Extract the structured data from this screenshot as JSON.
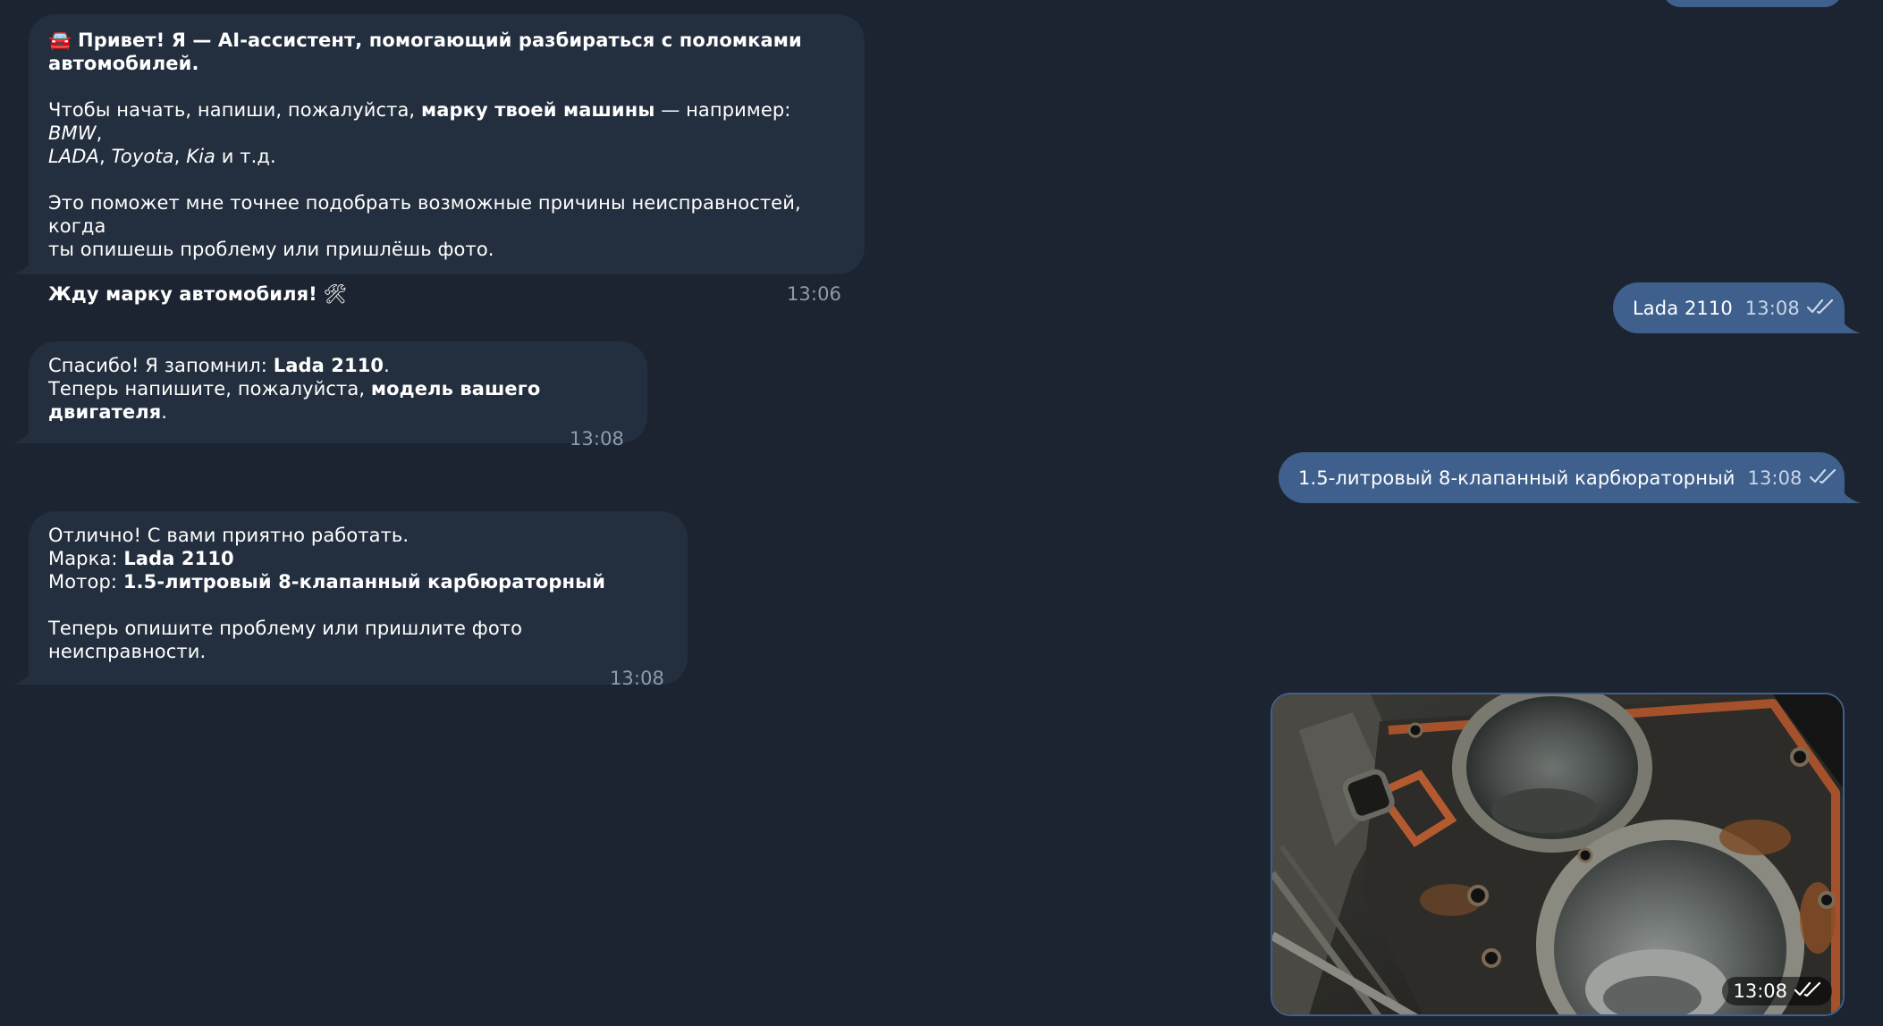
{
  "messages": {
    "m1": {
      "emoji": "🚘",
      "title_part1": "Привет! Я — AI-ассистент, помогающий разбираться с поломками",
      "title_part2": "автомобилей.",
      "p2_a": "Чтобы начать, напиши, пожалуйста, ",
      "p2_b": "марку твоей машины",
      "p2_c": " — например: ",
      "p2_d": "BMW",
      "p2_e": ",",
      "p2_f": "LADA",
      "p2_g": ", ",
      "p2_h": "Toyota",
      "p2_i": ", ",
      "p2_j": "Kia",
      "p2_k": " и т.д.",
      "p3_line1": "Это поможет мне точнее подобрать возможные причины неисправностей, когда",
      "p3_line2": "ты опишешь проблему или пришлёшь фото.",
      "p4": "Жду марку автомобиля!",
      "p4_emoji": "🛠",
      "time": "13:06"
    },
    "m2": {
      "text": "Lada 2110",
      "time": "13:08"
    },
    "m3": {
      "l1_a": "Спасибо! Я запомнил: ",
      "l1_b": "Lada 2110",
      "l1_c": ".",
      "l2_a": "Теперь напишите, пожалуйста, ",
      "l2_b": "модель вашего двигателя",
      "l2_c": ".",
      "time": "13:08"
    },
    "m4": {
      "text": "1.5-литровый 8-клапанный карбюраторный",
      "time": "13:08"
    },
    "m5": {
      "l1": "Отлично! С вами приятно работать.",
      "l2_a": "Марка: ",
      "l2_b": "Lada 2110",
      "l3_a": "Мотор: ",
      "l3_b": "1.5-литровый 8-клапанный карбюраторный",
      "l4": "Теперь опишите проблему или пришлите фото неисправности.",
      "time": "13:08"
    },
    "m6": {
      "time": "13:08"
    }
  },
  "icons": {
    "read_receipt": "double-check-icon"
  },
  "colors": {
    "background": "#1b2430",
    "incoming_bubble": "#232f3e",
    "outgoing_bubble": "#3f5f8c",
    "timestamp_incoming": "#8d9bab"
  }
}
